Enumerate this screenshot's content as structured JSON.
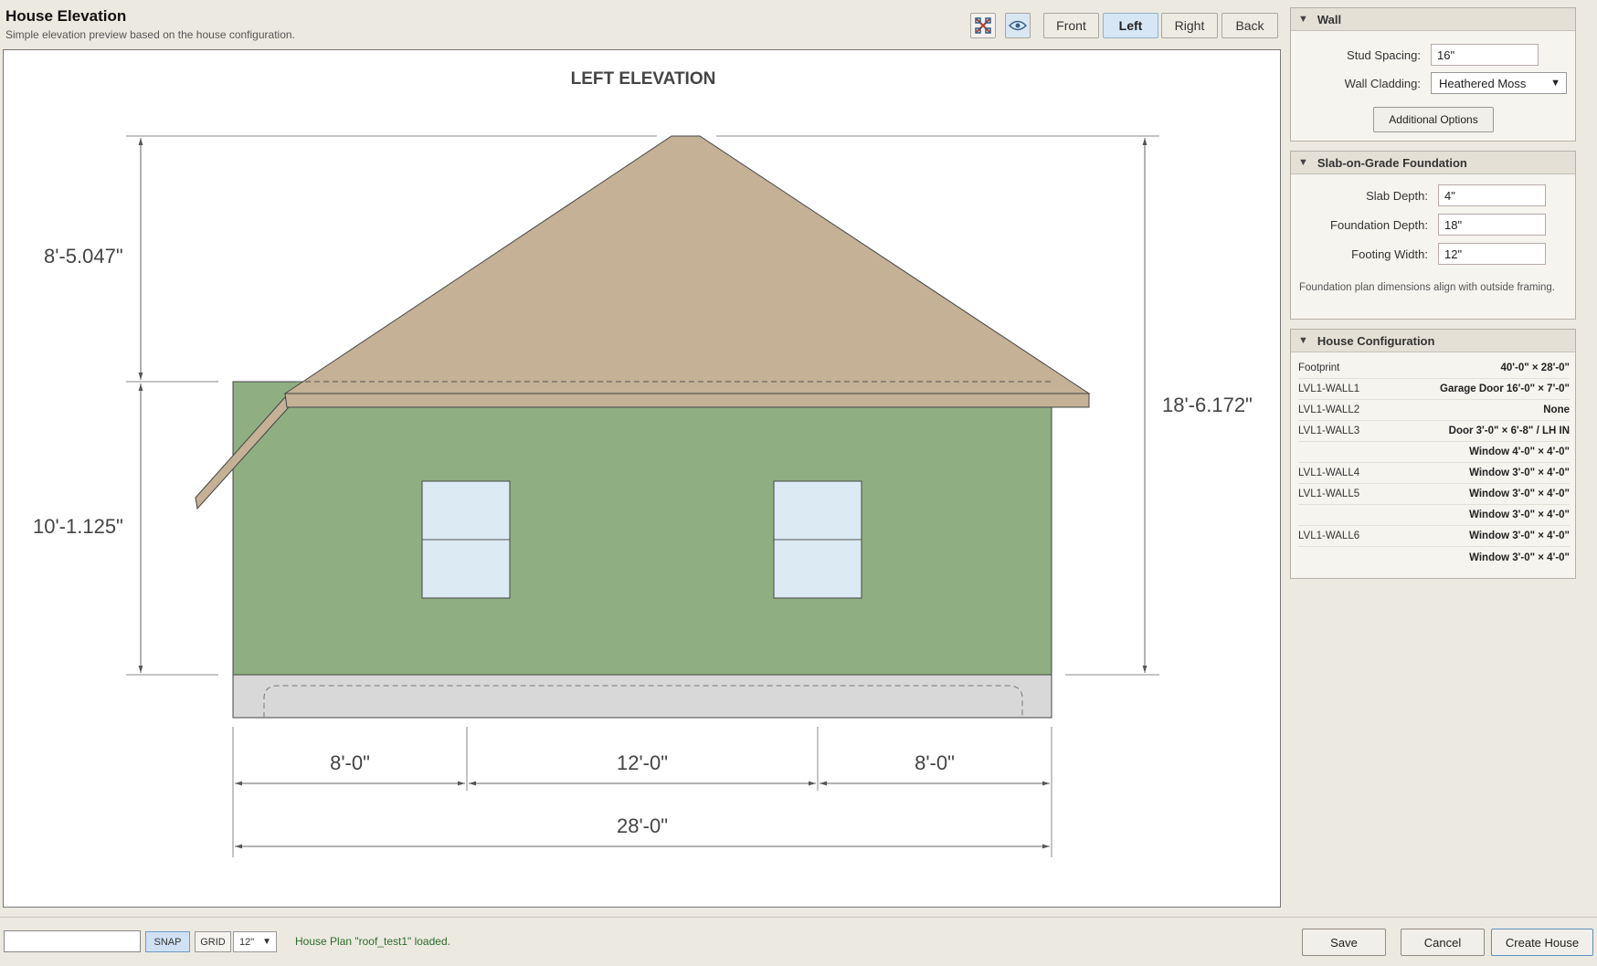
{
  "header": {
    "title": "House Elevation",
    "subtitle": "Simple elevation preview based on the house configuration."
  },
  "toolbar": {
    "icons": [
      "fit-view-icon",
      "eye-icon"
    ],
    "views": [
      {
        "label": "Front",
        "active": false
      },
      {
        "label": "Left",
        "active": true
      },
      {
        "label": "Right",
        "active": false
      },
      {
        "label": "Back",
        "active": false
      }
    ]
  },
  "drawing": {
    "title": "LEFT ELEVATION",
    "dims": {
      "roof_height": "8'-5.047\"",
      "wall_height": "10'-1.125\"",
      "total_height": "18'-6.172\"",
      "seg1": "8'-0\"",
      "seg2": "12'-0\"",
      "seg3": "8'-0\"",
      "overall": "28'-0\""
    },
    "colors": {
      "roof": "#c4b196",
      "wall": "#8faf83",
      "window": "#dbeaf3",
      "foundation": "#d8d8d8"
    }
  },
  "wall": {
    "header": "Wall",
    "stud_spacing_label": "Stud Spacing:",
    "stud_spacing_value": "16\"",
    "cladding_label": "Wall Cladding:",
    "cladding_value": "Heathered Moss",
    "options_button": "Additional Options"
  },
  "foundation": {
    "header": "Slab-on-Grade Foundation",
    "slab_depth_label": "Slab Depth:",
    "slab_depth_value": "4\"",
    "foundation_depth_label": "Foundation Depth:",
    "foundation_depth_value": "18\"",
    "footing_width_label": "Footing Width:",
    "footing_width_value": "12\"",
    "note": "Foundation plan dimensions align with outside framing."
  },
  "config": {
    "header": "House Configuration",
    "rows": [
      {
        "key": "Footprint",
        "value": "40'-0\" × 28'-0\""
      },
      {
        "key": "LVL1-WALL1",
        "value": "Garage Door 16'-0\" × 7'-0\""
      },
      {
        "key": "LVL1-WALL2",
        "value": "None"
      },
      {
        "key": "LVL1-WALL3",
        "value": "Door 3'-0\" × 6'-8\" / LH IN"
      },
      {
        "key": "",
        "value": "Window 4'-0\" × 4'-0\""
      },
      {
        "key": "LVL1-WALL4",
        "value": "Window 3'-0\" × 4'-0\""
      },
      {
        "key": "LVL1-WALL5",
        "value": "Window 3'-0\" × 4'-0\""
      },
      {
        "key": "",
        "value": "Window 3'-0\" × 4'-0\""
      },
      {
        "key": "LVL1-WALL6",
        "value": "Window 3'-0\" × 4'-0\""
      },
      {
        "key": "",
        "value": "Window 3'-0\" × 4'-0\""
      }
    ]
  },
  "footer": {
    "snap_label": "SNAP",
    "grid_label": "GRID",
    "grid_value": "12\"",
    "status": "House Plan \"roof_test1\" loaded.",
    "save_label": "Save",
    "cancel_label": "Cancel",
    "create_label": "Create House"
  }
}
